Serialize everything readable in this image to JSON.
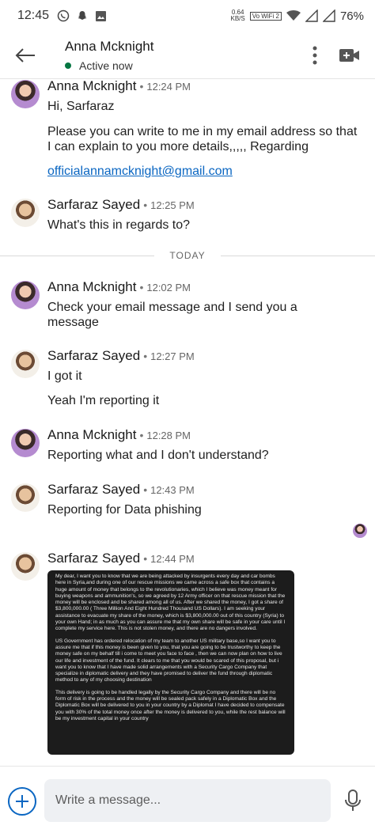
{
  "status_bar": {
    "time": "12:45",
    "net_speed": "0.64",
    "net_unit": "KB/S",
    "volte": "Vo WiFi 2",
    "battery": "76%"
  },
  "header": {
    "contact_name": "Anna Mcknight",
    "status": "Active now",
    "status_color": "#057642"
  },
  "messages": [
    {
      "sender": "Anna Mcknight",
      "time": "12:24 PM",
      "lines": [
        "Hi, Sarfaraz",
        "Please you can write to me in my email address so that I can explain to you more details,,,,, Regarding"
      ],
      "link": "officialannamcknight@gmail.com"
    },
    {
      "sender": "Sarfaraz Sayed",
      "time": "12:25 PM",
      "lines": [
        "What's this in regards to?"
      ]
    },
    {
      "sender": "Anna Mcknight",
      "time": "12:02 PM",
      "lines": [
        "Check your email message and I send you a message"
      ]
    },
    {
      "sender": "Sarfaraz Sayed",
      "time": "12:27 PM",
      "lines": [
        "I got it",
        "Yeah I'm reporting it"
      ]
    },
    {
      "sender": "Anna Mcknight",
      "time": "12:28 PM",
      "lines": [
        "Reporting what and I don't understand?"
      ]
    },
    {
      "sender": "Sarfaraz Sayed",
      "time": "12:43 PM",
      "lines": [
        "Reporting for Data phishing"
      ]
    },
    {
      "sender": "Sarfaraz Sayed",
      "time": "12:44 PM",
      "lines": []
    }
  ],
  "day_divider": "TODAY",
  "attachment": {
    "paragraphs": [
      "My dear, I want you to know that we are being attacked by insurgents every day and car bombs here in Syria,and during one of our rescue missions we came across a safe box that contains a huge amount of money that belongs to the revolutionaries, which I believe was money meant for buying weapons and ammunition's, so we agreed by 12 Army officer on that rescue mission that the money will be enclosed and be shared among all of us. After we shared the money, I got a share of $3,800,000.00 ( Three Million And Eight Hundred Thousand US Dollars). I am seeking your assistance to evacuate my share of the money, which is $3,800,000.00 out of this country (Syria) to your own Hand; in as much as you can assure me that my own share will be safe in your care until I complete my service here. This is not stolen money, and there are no dangers involved.",
      "US Government has ordered relocation of my team to another US military base,so I want you to assure me that if this money is been given to you, that you are going to be trustworthy to keep the money safe on my behalf till i come to meet you face to face , then we can now plan on how to live our life and investment of the fund. It clears to me that you would be scared of this proposal, but i want you to know that I have made solid arrangements with a Security Cargo Company that specialize in diplomatic delivery and they have promised to deliver the fund through diplomatic method to any of my choosing destination",
      "This delivery is going to be handled legally by the Security Cargo Company and there will be no form of risk in the process and the money will be sealed pack safely in a Diplomatic Box and the Diplomatic Box will be delivered to you in your country by a Diplomat I have decided to compensate you with 30% of the total money once after the money is delivered to you, while the rest balance will be my investment capital in your country"
    ]
  },
  "composer": {
    "placeholder": "Write a message..."
  },
  "icons": {
    "back": "back-arrow-icon",
    "more": "more-vertical-icon",
    "video": "video-call-icon",
    "plus": "plus-icon",
    "mic": "microphone-icon"
  },
  "accent": "#0a66c2"
}
